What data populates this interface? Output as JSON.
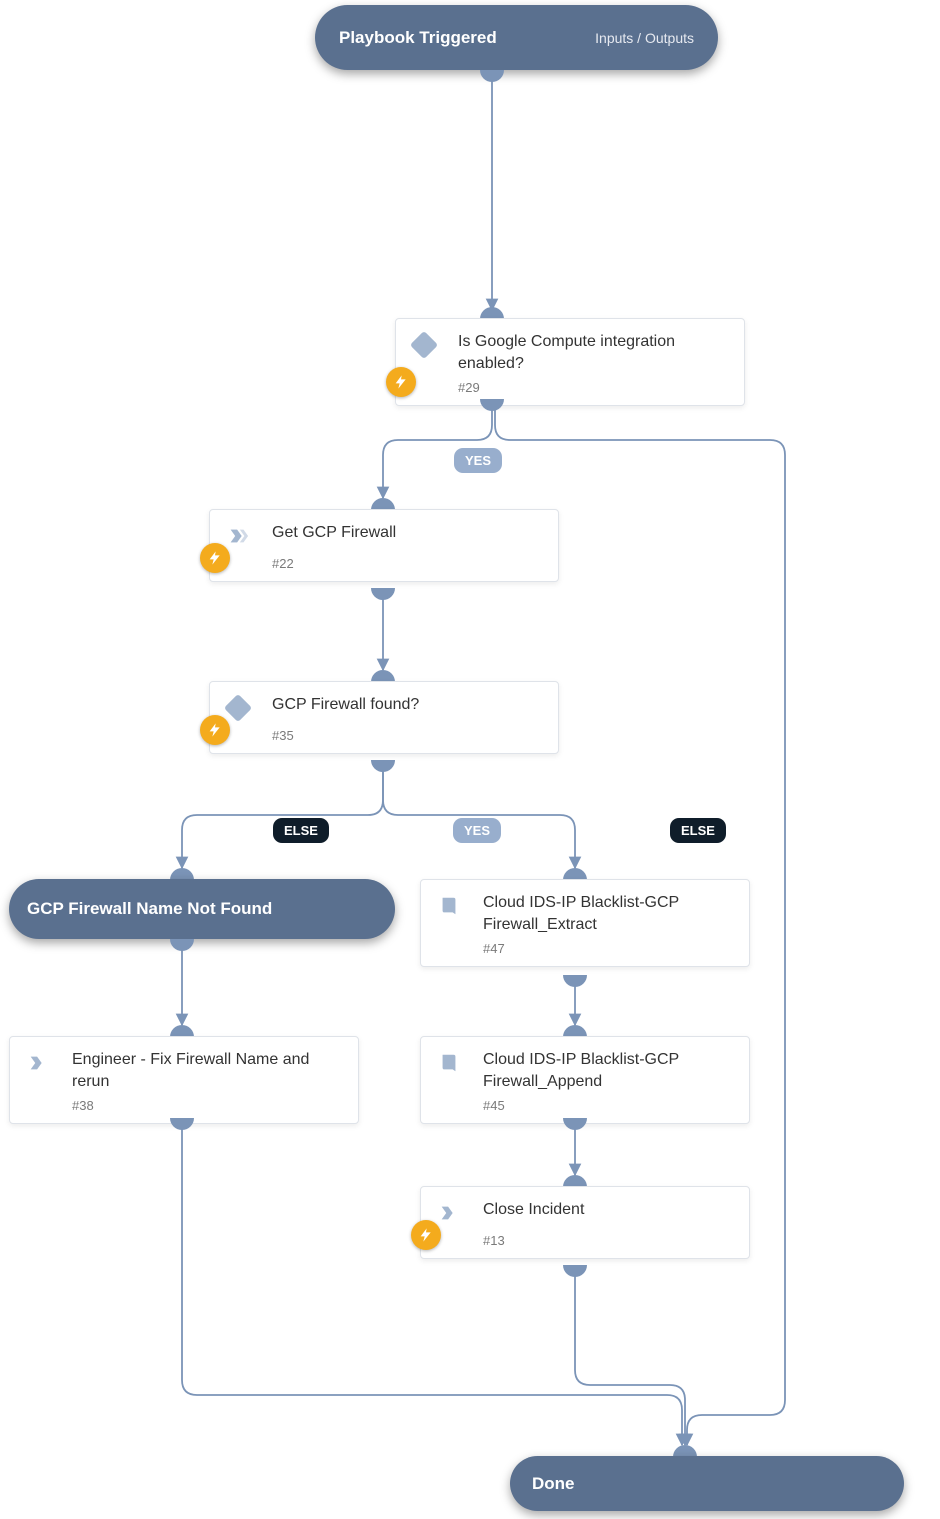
{
  "start": {
    "title": "Playbook Triggered",
    "io_label": "Inputs / Outputs"
  },
  "end": {
    "title": "Done"
  },
  "nodes": {
    "n29": {
      "label": "Is Google Compute integration enabled?",
      "id": "#29",
      "type": "condition"
    },
    "n22": {
      "label": "Get GCP Firewall",
      "id": "#22",
      "type": "chevron"
    },
    "n35": {
      "label": "GCP Firewall found?",
      "id": "#35",
      "type": "condition"
    },
    "notfound": {
      "label": "GCP Firewall Name Not Found"
    },
    "n38": {
      "label": "Engineer - Fix Firewall Name and rerun",
      "id": "#38",
      "type": "chevron"
    },
    "n47": {
      "label": "Cloud IDS-IP Blacklist-GCP Firewall_Extract",
      "id": "#47",
      "type": "book"
    },
    "n45": {
      "label": "Cloud IDS-IP Blacklist-GCP Firewall_Append",
      "id": "#45",
      "type": "book"
    },
    "n13": {
      "label": "Close Incident",
      "id": "#13",
      "type": "chevron"
    }
  },
  "badges": {
    "yes": "YES",
    "else": "ELSE"
  },
  "colors": {
    "node_border": "#dfe3e9",
    "accent": "#5a708f",
    "bolt": "#f4ab1d"
  }
}
